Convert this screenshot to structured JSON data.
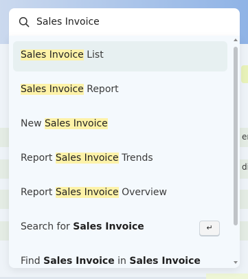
{
  "background": {
    "fragment_1": "en",
    "fragment_2": "di"
  },
  "search": {
    "value": "Sales Invoice",
    "icon": "search-icon"
  },
  "results": [
    {
      "parts": [
        {
          "t": "Sales Invoice",
          "mark": true
        },
        {
          "t": " List"
        }
      ],
      "active": true
    },
    {
      "parts": [
        {
          "t": "Sales Invoice",
          "mark": true
        },
        {
          "t": " Report"
        }
      ]
    },
    {
      "parts": [
        {
          "t": "New "
        },
        {
          "t": "Sales Invoice",
          "mark": true
        }
      ]
    },
    {
      "parts": [
        {
          "t": "Report "
        },
        {
          "t": "Sales Invoice",
          "mark": true
        },
        {
          "t": " Trends"
        }
      ]
    },
    {
      "parts": [
        {
          "t": "Report "
        },
        {
          "t": "Sales Invoice",
          "mark": true
        },
        {
          "t": " Overview"
        }
      ]
    },
    {
      "parts": [
        {
          "t": "Search for "
        },
        {
          "t": "Sales Invoice",
          "bold": true
        }
      ],
      "shortcut": "↵"
    },
    {
      "parts": [
        {
          "t": "Find "
        },
        {
          "t": "Sales Invoice",
          "bold": true
        },
        {
          "t": " in "
        },
        {
          "t": "Sales Invoice",
          "bold": true
        }
      ]
    }
  ],
  "colors": {
    "highlight": "#fdf2a8",
    "active_row": "#e7f0f1",
    "panel": "#f4f9fd"
  }
}
